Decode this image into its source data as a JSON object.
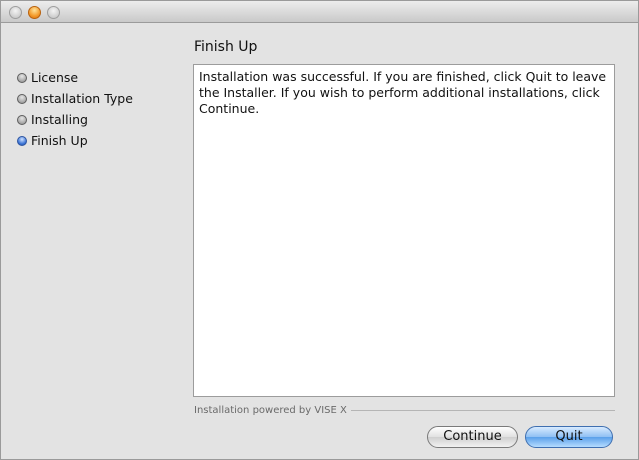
{
  "window": {
    "minimize_color": "#f39a2b"
  },
  "sidebar": {
    "steps": [
      {
        "label": "License",
        "active": false
      },
      {
        "label": "Installation Type",
        "active": false
      },
      {
        "label": "Installing",
        "active": false
      },
      {
        "label": "Finish Up",
        "active": true
      }
    ]
  },
  "main": {
    "title": "Finish Up",
    "message": "Installation was successful. If you are finished, click Quit to leave the Installer. If you wish to perform additional installations, click Continue."
  },
  "footer": {
    "powered_by": "Installation powered by VISE X",
    "continue_label": "Continue",
    "quit_label": "Quit"
  },
  "colors": {
    "active_step_bullet": "#3a73d6",
    "default_button": "#5aa0ea"
  }
}
